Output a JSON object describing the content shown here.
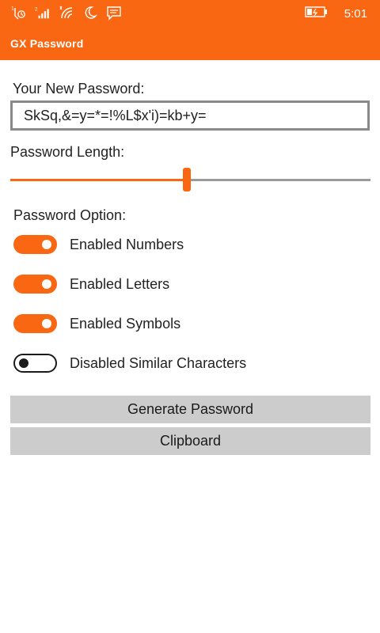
{
  "status_bar": {
    "time": "5:01",
    "icons": [
      "sim1-missed-call-icon",
      "sim2-signal-icon",
      "wifi-icon",
      "quiet-hours-icon",
      "message-icon"
    ],
    "sim1_label": "1",
    "sim2_label": "2",
    "battery_icon": "battery-charging-icon"
  },
  "app": {
    "title": "GX Password",
    "accent_color": "#f96712"
  },
  "password": {
    "label": "Your New Password:",
    "value": "SkSq,&=y=*=!%L$x'i)=kb+y="
  },
  "length": {
    "label": "Password Length:",
    "slider_fraction": 0.49
  },
  "options": {
    "label": "Password Option:",
    "items": [
      {
        "label": "Enabled Numbers",
        "on": true
      },
      {
        "label": "Enabled Letters",
        "on": true
      },
      {
        "label": "Enabled Symbols",
        "on": true
      },
      {
        "label": "Disabled Similar Characters",
        "on": false
      }
    ]
  },
  "buttons": {
    "generate": "Generate Password",
    "clipboard": "Clipboard"
  }
}
